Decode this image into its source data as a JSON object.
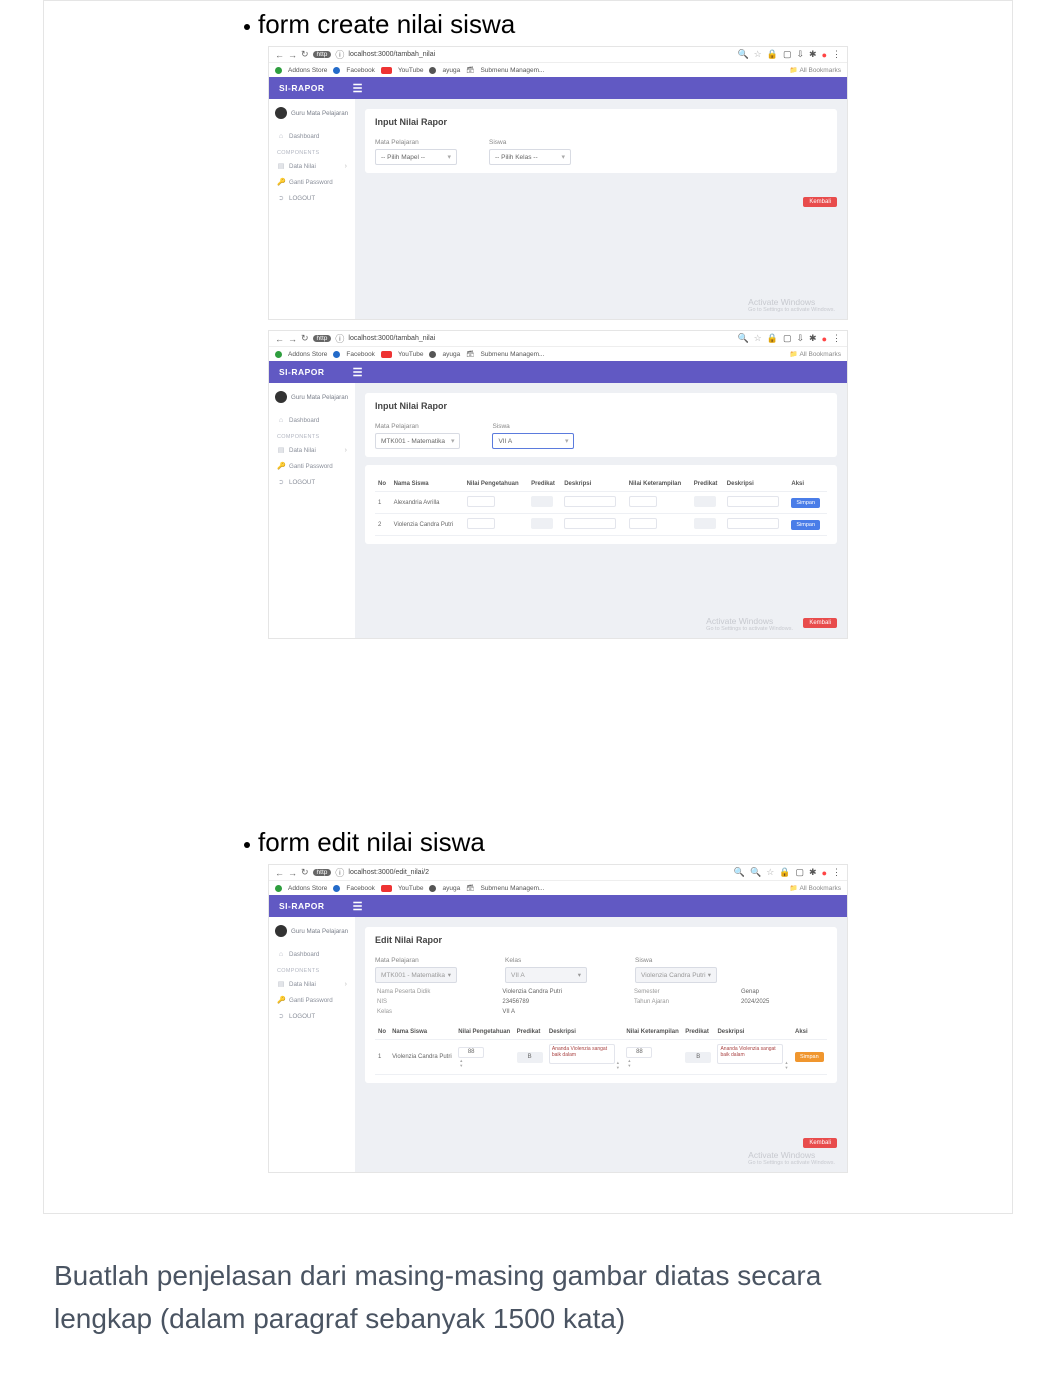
{
  "sections": {
    "create_title": "form create nilai siswa",
    "edit_title": "form edit nilai siswa"
  },
  "browser": {
    "url_create": "localhost:3000/tambah_nilai",
    "url_edit": "localhost:3000/edit_nilai/2",
    "bookmarks": [
      "Addons Store",
      "Facebook",
      "YouTube",
      "ayuga",
      "Submenu Managem..."
    ],
    "all_bookmarks": "All Bookmarks"
  },
  "app": {
    "brand": "SI-RAPOR",
    "user_role": "Guru Mata Pelajaran",
    "nav": {
      "dashboard": "Dashboard",
      "components": "COMPONENTS",
      "data_nilai": "Data Nilai",
      "ganti_password": "Ganti Password",
      "logout": "LOGOUT"
    }
  },
  "screen_create_empty": {
    "title": "Input Nilai Rapor",
    "mapel_label": "Mata Pelajaran",
    "mapel_placeholder": "-- Pilih Mapel --",
    "siswa_label": "Siswa",
    "siswa_placeholder": "-- Pilih Kelas --",
    "kembali": "Kembali"
  },
  "screen_create_table": {
    "title": "Input Nilai Rapor",
    "mapel_label": "Mata Pelajaran",
    "mapel_value": "MTK001 - Matematika",
    "siswa_label": "Siswa",
    "siswa_value": "VII A",
    "headers": {
      "no": "No",
      "nama": "Nama Siswa",
      "nilai_p": "Nilai Pengetahuan",
      "pred_p": "Predikat",
      "desk_p": "Deskripsi",
      "nilai_k": "Nilai Keterampilan",
      "pred_k": "Predikat",
      "desk_k": "Deskripsi",
      "aksi": "Aksi"
    },
    "rows": [
      {
        "no": "1",
        "nama": "Alexandria Avrilla"
      },
      {
        "no": "2",
        "nama": "Violenzia Candra Putri"
      }
    ],
    "btn_simpan": "Simpan",
    "kembali": "Kembali"
  },
  "screen_edit": {
    "title": "Edit Nilai Rapor",
    "mapel_label": "Mata Pelajaran",
    "mapel_value": "MTK001 - Matematika",
    "kelas_label": "Kelas",
    "kelas_value": "VII A",
    "siswa_label": "Siswa",
    "siswa_value": "Violenzia Candra Putri",
    "info": {
      "nama_label": "Nama Peserta Didik",
      "nama_value": "Violenzia Candra Putri",
      "nis_label": "NIS",
      "nis_value": "23456789",
      "kelas_label": "Kelas",
      "kelas_value": "VII A",
      "semester_label": "Semester",
      "semester_value": "Genap",
      "tahun_label": "Tahun Ajaran",
      "tahun_value": "2024/2025"
    },
    "headers": {
      "no": "No",
      "nama": "Nama Siswa",
      "nilai_p": "Nilai Pengetahuan",
      "pred_p": "Predikat",
      "desk_p": "Deskripsi",
      "nilai_k": "Nilai Keterampilan",
      "pred_k": "Predikat",
      "desk_k": "Deskripsi",
      "aksi": "Aksi"
    },
    "row": {
      "no": "1",
      "nama": "Violenzia Candra Putri",
      "nilai_p": "88",
      "pred_p": "B",
      "desk_p": "Ananda Violenzia sangat baik dalam",
      "nilai_k": "88",
      "pred_k": "B",
      "desk_k": "Ananda Violenzia sangat baik dalam"
    },
    "btn_simpan": "Simpan",
    "kembali": "Kembali"
  },
  "watermark": {
    "title": "Activate Windows",
    "sub": "Go to Settings to activate Windows."
  },
  "instruction": "Buatlah penjelasan dari masing-masing gambar diatas secara lengkap (dalam paragraf sebanyak 1500 kata)"
}
